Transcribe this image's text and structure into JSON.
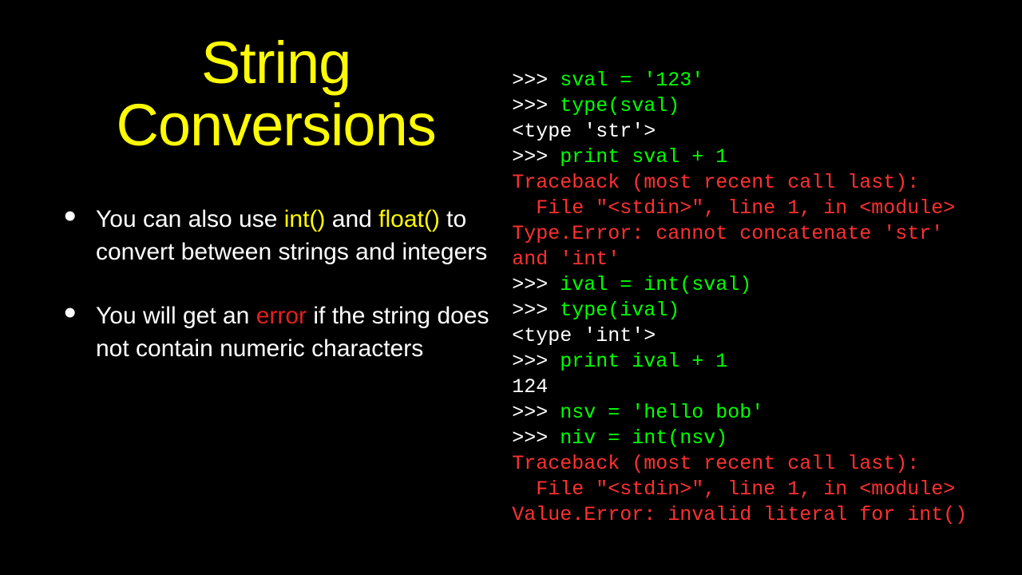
{
  "title": "String Conversions",
  "bullets": {
    "b1": {
      "pre": "You can also use ",
      "hl1": "int()",
      "mid": " and ",
      "hl2": "float()",
      "post": " to convert between strings and integers"
    },
    "b2": {
      "pre": "You will get an ",
      "hl": "error",
      "post": " if the string does not contain numeric characters"
    }
  },
  "code": {
    "p1": ">>> ",
    "c1": "sval = '123'",
    "p2": ">>> ",
    "c2": "type(sval)",
    "o1": "<type 'str'>",
    "p3": ">>> ",
    "c3": "print sval + 1",
    "e1": "Traceback (most recent call last):",
    "e2": "  File \"<stdin>\", line 1, in <module>",
    "e3": "Type.Error: cannot concatenate 'str'",
    "e3b": "and 'int'",
    "p4": ">>> ",
    "c4": "ival = int(sval)",
    "p5": ">>> ",
    "c5": "type(ival)",
    "o2": "<type 'int'>",
    "p6": ">>> ",
    "c6": "print ival + 1",
    "o3": "124",
    "p7": ">>> ",
    "c7": "nsv = 'hello bob'",
    "p8": ">>> ",
    "c8": "niv = int(nsv)",
    "e4": "Traceback (most recent call last):",
    "e5": "  File \"<stdin>\", line 1, in <module>",
    "e6": "Value.Error: invalid literal for int()"
  }
}
